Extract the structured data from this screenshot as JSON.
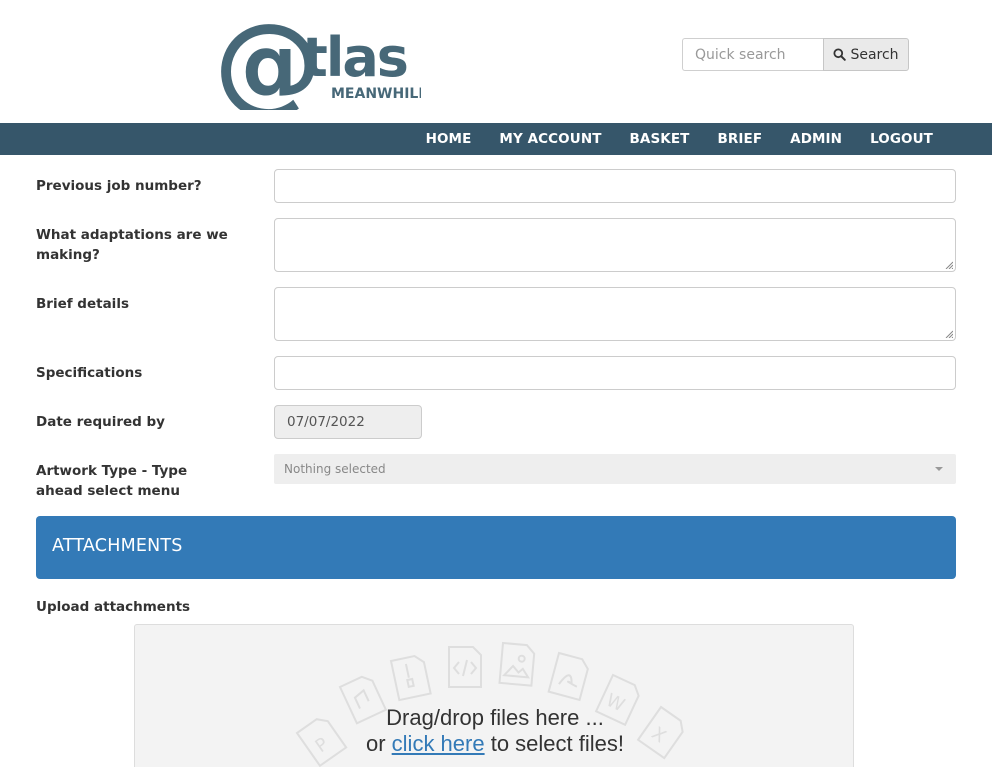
{
  "brand": {
    "logo_letter": "@",
    "logo_word": "tlas",
    "logo_sub": "MEANWHILE",
    "logo_color": "#476878"
  },
  "search": {
    "placeholder": "Quick search",
    "button_label": "Search"
  },
  "nav": {
    "items": [
      {
        "label": "HOME"
      },
      {
        "label": "MY ACCOUNT"
      },
      {
        "label": "BASKET"
      },
      {
        "label": "BRIEF"
      },
      {
        "label": "ADMIN"
      },
      {
        "label": "LOGOUT"
      }
    ],
    "background": "#36566a"
  },
  "form": {
    "previous_job": {
      "label": "Previous job number?",
      "value": ""
    },
    "adaptations": {
      "label": "What adaptations are we making?",
      "value": ""
    },
    "brief_details": {
      "label": "Brief details",
      "value": ""
    },
    "specifications": {
      "label": "Specifications",
      "value": ""
    },
    "date_required": {
      "label": "Date required by",
      "value": "07/07/2022"
    },
    "artwork_type": {
      "label": "Artwork Type - Type ahead select menu",
      "selected": "Nothing selected"
    }
  },
  "attachments": {
    "title": "ATTACHMENTS",
    "accent": "#337ab7",
    "upload_label": "Upload attachments",
    "drop_text": "Drag/drop files here ...",
    "drop_or": "or",
    "drop_link": "click here",
    "drop_suffix": "to select files!"
  }
}
